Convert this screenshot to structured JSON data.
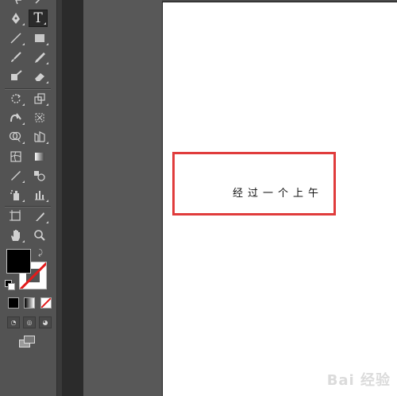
{
  "canvas": {
    "text": "经过一个上午"
  },
  "watermark": {
    "text": "Bai 经验"
  },
  "colors": {
    "fill": "#000000",
    "stroke": "none",
    "highlight": "#e03c3c"
  },
  "tools": [
    "direct-selection-icon",
    "magic-wand-icon",
    "pen-icon",
    "type-icon",
    "line-segment-icon",
    "rectangle-icon",
    "paintbrush-icon",
    "pencil-icon",
    "blob-brush-icon",
    "eraser-icon",
    "rotate-icon",
    "scale-icon",
    "warp-icon",
    "free-transform-icon",
    "shape-builder-icon",
    "perspective-grid-icon",
    "mesh-icon",
    "gradient-icon",
    "eyedropper-icon",
    "blend-icon",
    "symbol-sprayer-icon",
    "column-graph-icon",
    "artboard-icon",
    "slice-icon",
    "hand-icon",
    "zoom-icon"
  ]
}
